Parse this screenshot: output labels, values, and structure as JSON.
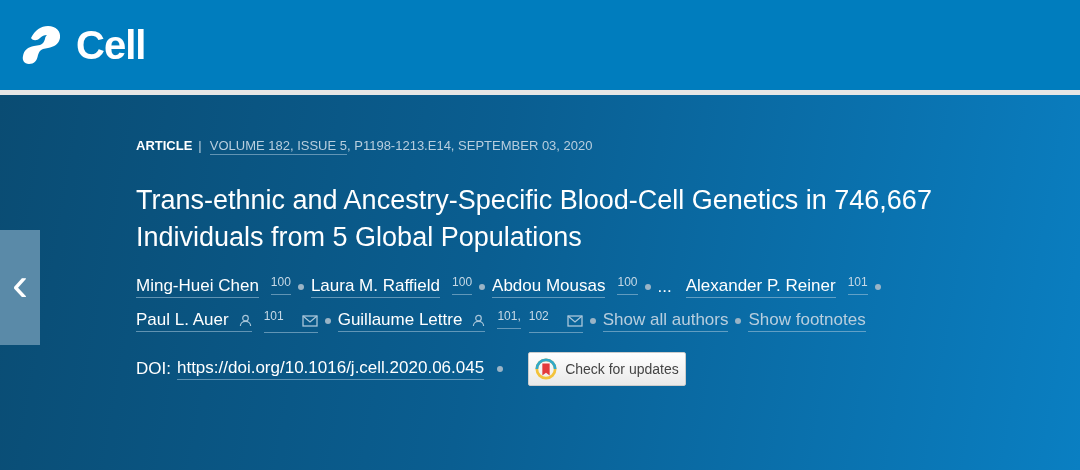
{
  "header": {
    "logo_text": "Cell"
  },
  "article": {
    "type": "ARTICLE",
    "separator": "|",
    "volume": "VOLUME 182, ISSUE 5",
    "citation": ", P1198-1213.E14, SEPTEMBER 03, 2020",
    "title": "Trans-ethnic and Ancestry-Specific Blood-Cell Genetics in 746,667 Individuals from 5 Global Populations",
    "author_lines": [
      [
        {
          "kind": "author",
          "name": "Ming-Huei Chen",
          "sups": [
            "100"
          ],
          "person": false,
          "mail": false
        },
        {
          "kind": "author",
          "name": "Laura M. Raffield",
          "sups": [
            "100"
          ],
          "person": false,
          "mail": false
        },
        {
          "kind": "author",
          "name": "Abdou Mousas",
          "sups": [
            "100"
          ],
          "person": false,
          "mail": false
        },
        {
          "kind": "ellipsis",
          "name": "..."
        },
        {
          "kind": "author",
          "name": "Alexander P. Reiner",
          "sups": [
            "101"
          ],
          "person": false,
          "mail": false
        }
      ],
      [
        {
          "kind": "author",
          "name": "Paul L. Auer",
          "sups": [
            "101"
          ],
          "person": true,
          "mail": true
        },
        {
          "kind": "author",
          "name": "Guillaume Lettre",
          "sups": [
            "101,",
            "102"
          ],
          "person": true,
          "mail": true
        },
        {
          "kind": "link",
          "name": "Show all authors"
        },
        {
          "kind": "link",
          "name": "Show footnotes"
        }
      ]
    ],
    "doi_label": "DOI:",
    "doi": "https://doi.org/10.1016/j.cell.2020.06.045",
    "updates_button": "Check for updates"
  },
  "nav": {
    "prev": "‹"
  }
}
